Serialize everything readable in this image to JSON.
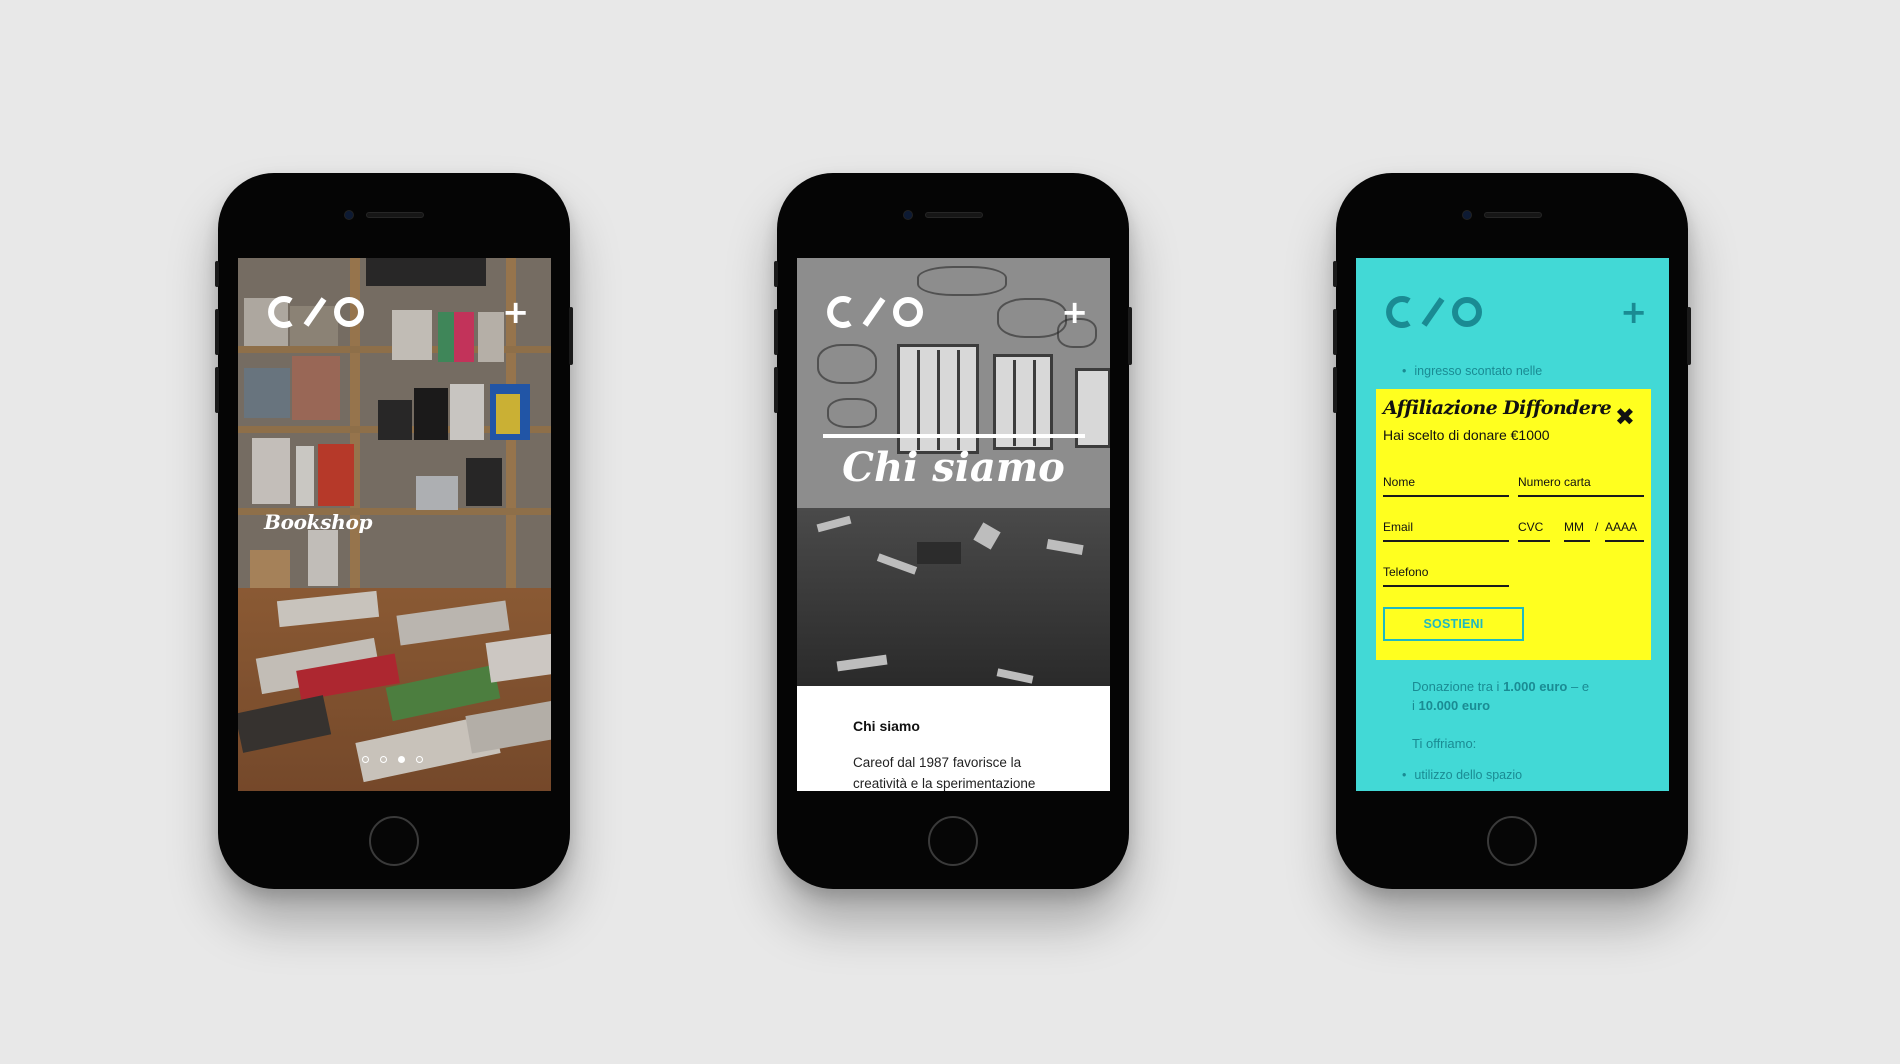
{
  "brand": {
    "logo_text": "C/O",
    "menu_icon": "plus-icon",
    "colors": {
      "teal": "#42d9d6",
      "teal_text": "#1a8b93",
      "yellow": "#ffff1f",
      "button_teal": "#1fb9c1",
      "background": "#e8e8e8"
    }
  },
  "phone1": {
    "title": "Bookshop",
    "slides_total": 4,
    "active_slide": 3
  },
  "phone2": {
    "hero_title": "Chi siamo",
    "section_heading": "Chi siamo",
    "body_line1": "Careof dal 1987 favorisce la",
    "body_line2": "creatività e la sperimentazione"
  },
  "phone3": {
    "list_top": [
      "ingresso scontato nelle"
    ],
    "modal": {
      "title": "Affiliazione Diffondere",
      "subtitle": "Hai scelto di donare €1000",
      "fields": {
        "nome": "Nome",
        "numero_carta": "Numero carta",
        "email": "Email",
        "cvc": "CVC",
        "mm": "MM",
        "slash": "/",
        "aaaa": "AAAA",
        "telefono": "Telefono"
      },
      "submit": "SOSTIENI"
    },
    "donation": {
      "line1_prefix": "Donazione tra i ",
      "line1_amount": "1.000 euro",
      "line1_suffix": " – e",
      "line2_prefix": "i ",
      "line2_amount": "10.000 euro"
    },
    "offer_heading": "Ti offriamo:",
    "offer_items": [
      "utilizzo dello spazio"
    ]
  }
}
